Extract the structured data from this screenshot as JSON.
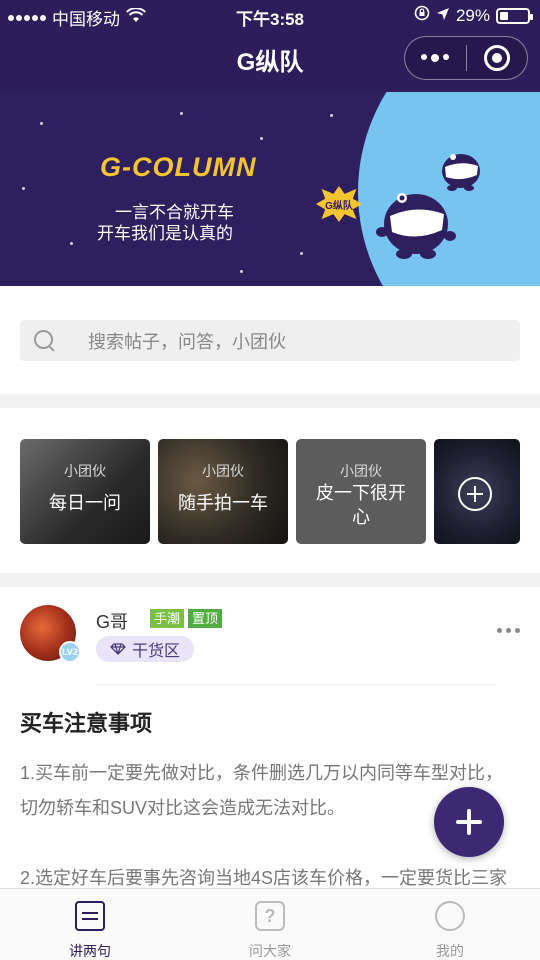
{
  "status_bar": {
    "carrier": "中国移动",
    "time": "下午3:58",
    "battery_text": "29%",
    "battery_level": 0.29
  },
  "nav": {
    "title": "G纵队"
  },
  "banner": {
    "brand": "G-COLUMN",
    "line1": "一言不合就开车",
    "line2": "开车我们是认真的",
    "badge": "G纵队"
  },
  "search": {
    "placeholder": "搜索帖子，问答，小团伙"
  },
  "groups": [
    {
      "tag": "小团伙",
      "name": "每日一问"
    },
    {
      "tag": "小团伙",
      "name": "随手拍一车"
    },
    {
      "tag": "小团伙",
      "name": "皮一下很开心"
    }
  ],
  "post": {
    "author": "G哥",
    "level": "LV2",
    "tags": [
      "手潮",
      "置顶"
    ],
    "zone": "干货区",
    "title": "买车注意事项",
    "paragraph1": "1.买车前一定要先做对比，条件删选几万以内同等车型对比，切勿轿车和SUV对比这会造成无法对比。",
    "paragraph2": "2.选定好车后要事先咨询当地4S店该车价格，一定要货比三家"
  },
  "tabs": [
    {
      "label": "讲两句",
      "icon": "calendar-icon"
    },
    {
      "label": "问大家",
      "icon": "question-icon"
    },
    {
      "label": "我的",
      "icon": "user-icon"
    }
  ],
  "colors": {
    "primary": "#2d1d5b",
    "banner_circle": "#76c4ef",
    "brand_yellow": "#f5c431",
    "tag_green": "#79c043",
    "tag_green_dark": "#4fae3f"
  }
}
